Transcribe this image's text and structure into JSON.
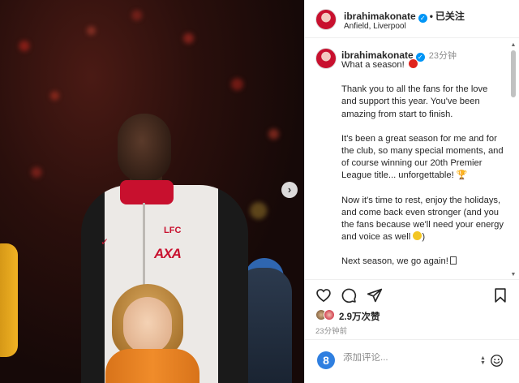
{
  "post": {
    "username": "ibrahimakonate",
    "follow_status": "已关注",
    "location": "Anfield, Liverpool"
  },
  "comment": {
    "username": "ibrahimakonate",
    "time": "23分钟",
    "caption": [
      "What a season!",
      "Thank you to all the fans for the love and support this year. You've been amazing from start to finish.",
      "It's been a great season for me and for the club, so many special moments, and of course winning our 20th Premier League title... unforgettable!",
      "Now it's time to rest, enjoy the holidays, and come back even stronger (and you the fans because we'll need your energy and voice as well",
      "Next season, we go again!"
    ]
  },
  "photo": {
    "shirt_sponsor": "AXA",
    "crest_text": "LFC"
  },
  "stats": {
    "likes": "2.9万次赞",
    "posted": "23分钟前"
  },
  "composer": {
    "placeholder": "添加评论..."
  },
  "icons": {
    "like": "heart-icon",
    "comment": "comment-icon",
    "share": "send-icon",
    "save": "bookmark-icon",
    "emoji": "smile-icon",
    "next": "chevron-right-icon"
  },
  "colors": {
    "verified": "#0095f6",
    "liverpool_red": "#c8102e",
    "muted_text": "#8e8e8e"
  }
}
